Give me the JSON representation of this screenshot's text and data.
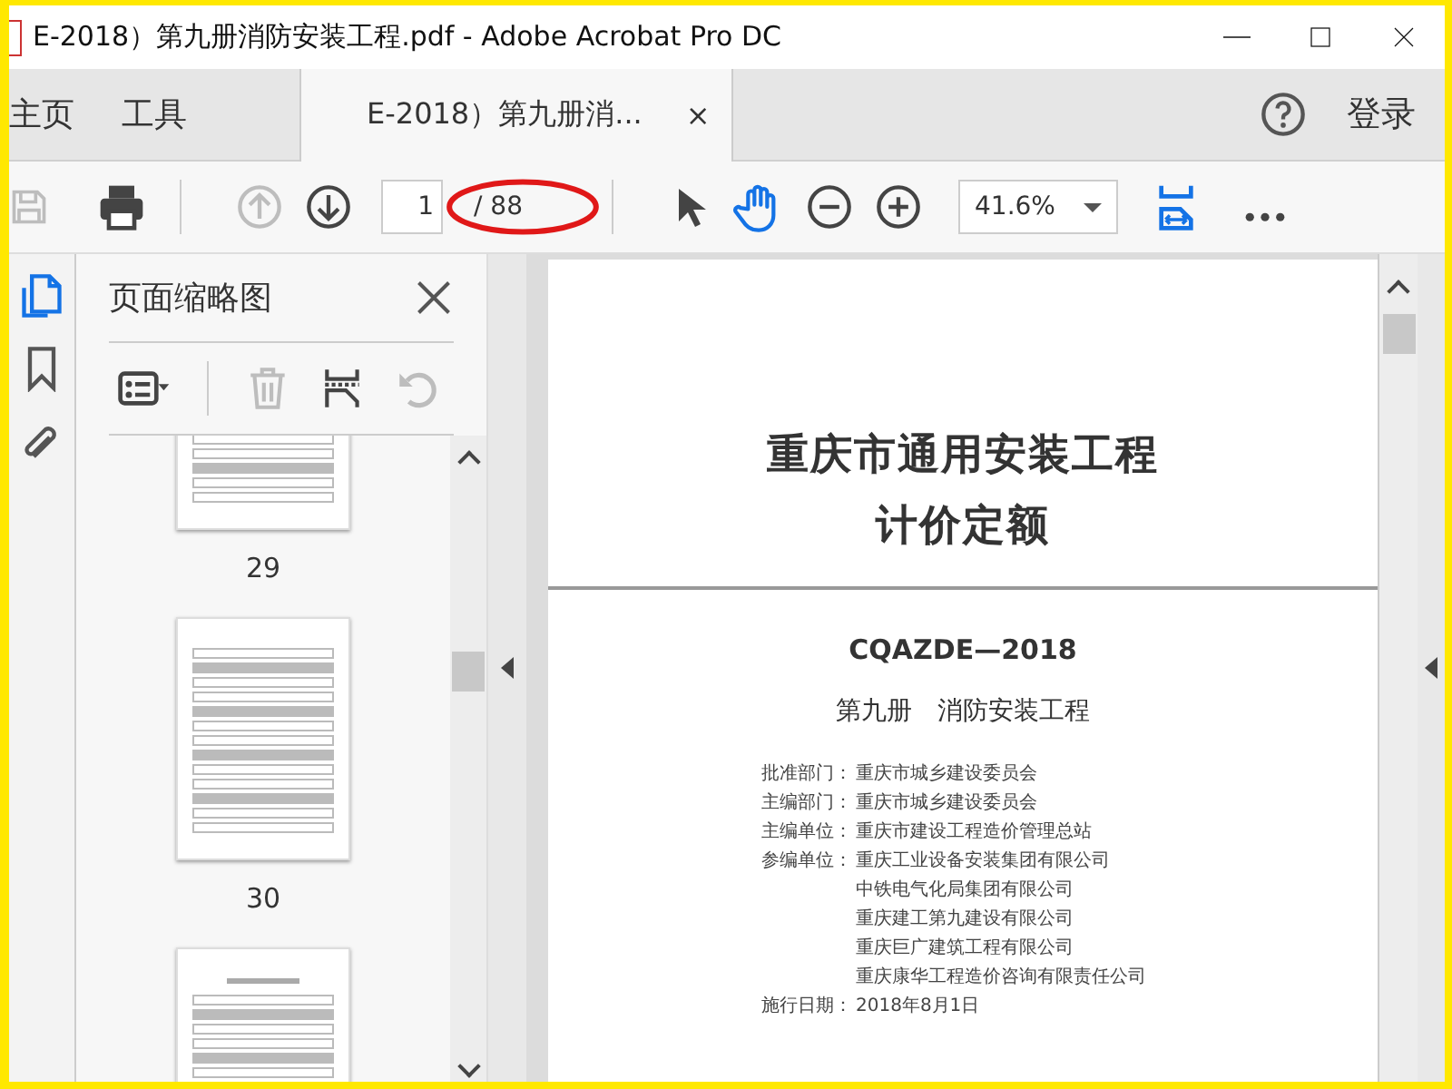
{
  "window": {
    "title": "E-2018）第九册消防安装工程.pdf - Adobe Acrobat Pro DC"
  },
  "tabs": [
    {
      "label": "主页",
      "selected": false
    },
    {
      "label": "工具",
      "selected": false
    },
    {
      "label": "E-2018）第九册消...",
      "selected": true,
      "close": "×"
    }
  ],
  "account": {
    "label": "登录"
  },
  "toolbar": {
    "tools": [
      {
        "kind": "save",
        "disabled": true
      },
      {
        "kind": "print",
        "disabled": false
      },
      {
        "kind": "sep"
      },
      {
        "kind": "prev",
        "disabled": true
      },
      {
        "kind": "next",
        "disabled": false
      },
      {
        "kind": "page"
      },
      {
        "kind": "sep"
      },
      {
        "kind": "select",
        "selected": false
      },
      {
        "kind": "hand",
        "selected": true
      },
      {
        "kind": "zoomout",
        "disabled": false
      },
      {
        "kind": "zoomin",
        "disabled": false
      },
      {
        "kind": "zoom"
      },
      {
        "kind": "fit"
      },
      {
        "kind": "more"
      }
    ],
    "page_field": {
      "value": "1"
    },
    "page_count": "/ 88",
    "zoom": "41.6%"
  },
  "annotation": {
    "kind": "ellipse"
  },
  "rail": [
    {
      "kind": "pages",
      "selected": true
    },
    {
      "kind": "bookmarks",
      "selected": false
    },
    {
      "kind": "attachments",
      "selected": false
    }
  ],
  "panel": {
    "title": "页面缩略图",
    "tools": [
      {
        "kind": "options",
        "disabled": false
      },
      {
        "kind": "sep"
      },
      {
        "kind": "delete",
        "disabled": true
      },
      {
        "kind": "insert",
        "disabled": false
      },
      {
        "kind": "rotate",
        "disabled": true
      }
    ],
    "thumbnails": [
      {
        "kind": "table",
        "label": "29"
      },
      {
        "kind": "table",
        "label": "30"
      },
      {
        "kind": "partial"
      }
    ]
  },
  "document": {
    "title_lines": [
      "重庆市通用安装工程",
      "计价定额"
    ],
    "code": "CQAZDE—2018",
    "volume": "第九册　消防安装工程",
    "credits": [
      {
        "label": "批准部门：",
        "value": "重庆市城乡建设委员会"
      },
      {
        "label": "主编部门：",
        "value": "重庆市城乡建设委员会"
      },
      {
        "label": "主编单位：",
        "value": "重庆市建设工程造价管理总站"
      },
      {
        "label": "参编单位：",
        "value": "重庆工业设备安装集团有限公司"
      },
      {
        "value": "中铁电气化局集团有限公司"
      },
      {
        "value": "重庆建工第九建设有限公司"
      },
      {
        "value": "重庆巨广建筑工程有限公司"
      },
      {
        "value": "重庆康华工程造价咨询有限责任公司"
      },
      {
        "label": "施行日期：",
        "value": "2018年8月1日"
      }
    ]
  }
}
